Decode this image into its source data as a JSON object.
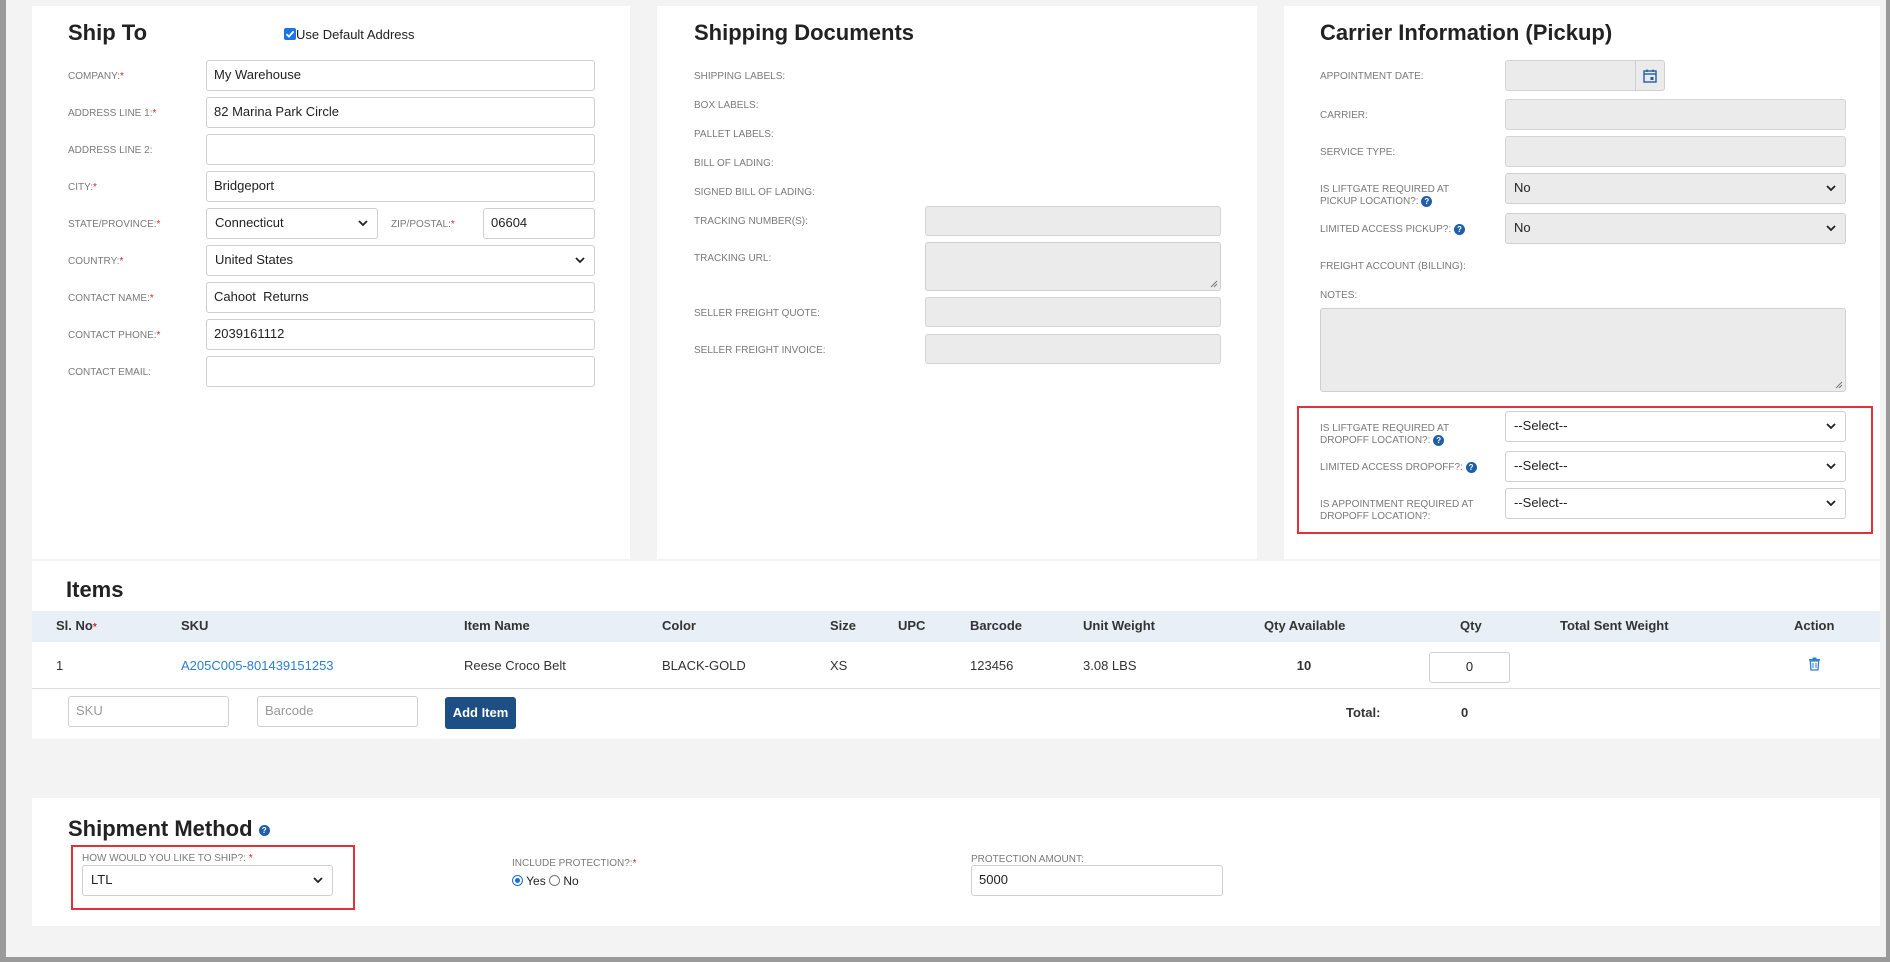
{
  "ship_to": {
    "title": "Ship To",
    "use_default_label": "Use Default Address",
    "company_label": "COMPANY:",
    "company_value": "My Warehouse",
    "address1_label": "ADDRESS LINE 1:",
    "address1_value": "82 Marina Park Circle",
    "address2_label": "ADDRESS LINE 2:",
    "address2_value": "",
    "city_label": "CITY:",
    "city_value": "Bridgeport",
    "state_label": "STATE/PROVINCE:",
    "state_value": "Connecticut",
    "zip_label": "ZIP/POSTAL:",
    "zip_value": "06604",
    "country_label": "COUNTRY:",
    "country_value": "United States",
    "contact_name_label": "CONTACT NAME:",
    "contact_name_value": "Cahoot  Returns",
    "contact_phone_label": "CONTACT PHONE:",
    "contact_phone_value": "2039161112",
    "contact_email_label": "CONTACT EMAIL:",
    "contact_email_value": "",
    "required_mark": "*"
  },
  "shipping_docs": {
    "title": "Shipping Documents",
    "shipping_labels": "SHIPPING LABELS:",
    "box_labels": "BOX LABELS:",
    "pallet_labels": "PALLET LABELS:",
    "bill_of_lading": "BILL OF LADING:",
    "signed_bol": "SIGNED BILL OF LADING:",
    "tracking_numbers": "TRACKING NUMBER(S):",
    "tracking_url": "TRACKING URL:",
    "seller_quote": "SELLER FREIGHT QUOTE:",
    "seller_invoice": "SELLER FREIGHT INVOICE:"
  },
  "carrier": {
    "title": "Carrier Information (Pickup)",
    "appointment_date": "APPOINTMENT DATE:",
    "carrier": "CARRIER:",
    "service_type": "SERVICE TYPE:",
    "liftgate_pickup_l1": "IS LIFTGATE REQUIRED AT",
    "liftgate_pickup_l2": "PICKUP LOCATION?:",
    "liftgate_pickup_value": "No",
    "limited_pickup": "LIMITED ACCESS PICKUP?:",
    "limited_pickup_value": "No",
    "freight_account": "FREIGHT ACCOUNT (BILLING):",
    "notes": "NOTES:",
    "liftgate_dropoff_l1": "IS LIFTGATE REQUIRED AT",
    "liftgate_dropoff_l2": "DROPOFF LOCATION?:",
    "liftgate_dropoff_value": "--Select--",
    "limited_dropoff": "LIMITED ACCESS DROPOFF?:",
    "limited_dropoff_value": "--Select--",
    "appointment_dropoff_l1": "IS APPOINTMENT REQUIRED AT",
    "appointment_dropoff_l2": "DROPOFF LOCATION?:",
    "appointment_dropoff_value": "--Select--"
  },
  "items": {
    "title": "Items",
    "columns": [
      "Sl. No",
      "SKU",
      "Item Name",
      "Color",
      "Size",
      "UPC",
      "Barcode",
      "Unit Weight",
      "Qty Available",
      "Qty",
      "Total Sent Weight",
      "Action"
    ],
    "required_mark": "*",
    "rows": [
      {
        "sl": "1",
        "sku": "A205C005-801439151253",
        "name": "Reese Croco Belt",
        "color": "BLACK-GOLD",
        "size": "XS",
        "upc": "",
        "barcode": "123456",
        "unit_weight": "3.08 LBS",
        "qty_available": "10",
        "qty": "0",
        "total_sent_weight": ""
      }
    ],
    "sku_placeholder": "SKU",
    "barcode_placeholder": "Barcode",
    "add_item_label": "Add Item",
    "total_label": "Total:",
    "total_value": "0"
  },
  "shipment": {
    "title": "Shipment Method",
    "how_label": "HOW WOULD YOU LIKE TO SHIP?:",
    "how_value": "LTL",
    "protection_label": "INCLUDE PROTECTION?:",
    "yes_label": "Yes",
    "no_label": "No",
    "protection_selected": "Yes",
    "amount_label": "PROTECTION AMOUNT:",
    "amount_value": "5000"
  },
  "colors": {
    "accent": "#1d4f86",
    "link": "#2a7fd4",
    "highlight": "#e0323a",
    "table_header_bg": "#e8eff7"
  }
}
